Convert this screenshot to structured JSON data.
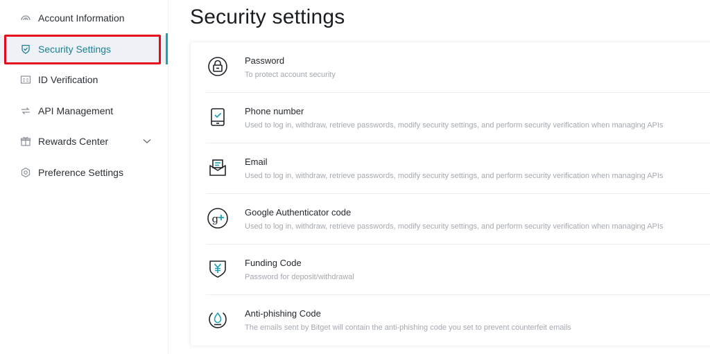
{
  "sidebar": {
    "items": [
      {
        "label": "Account Information",
        "icon": "dashboard-gauge-icon",
        "active": false
      },
      {
        "label": "Security Settings",
        "icon": "shield-check-icon",
        "active": true
      },
      {
        "label": "ID Verification",
        "icon": "id-card-icon",
        "active": false
      },
      {
        "label": "API Management",
        "icon": "api-arrows-icon",
        "active": false
      },
      {
        "label": "Rewards Center",
        "icon": "gift-icon",
        "active": false,
        "expandable": true
      },
      {
        "label": "Preference Settings",
        "icon": "hexagon-gear-icon",
        "active": false
      }
    ]
  },
  "main": {
    "title": "Security settings",
    "settings": [
      {
        "title": "Password",
        "description": "To protect account security",
        "icon": "lock-icon"
      },
      {
        "title": "Phone number",
        "description": "Used to log in, withdraw, retrieve passwords, modify security settings, and perform security verification when managing APIs",
        "icon": "phone-check-icon"
      },
      {
        "title": "Email",
        "description": "Used to log in, withdraw, retrieve passwords, modify security settings, and perform security verification when managing APIs",
        "icon": "envelope-icon"
      },
      {
        "title": "Google Authenticator code",
        "description": "Used to log in, withdraw, retrieve passwords, modify security settings, and perform security verification when managing APIs",
        "icon": "google-plus-icon"
      },
      {
        "title": "Funding Code",
        "description": "Password for deposit/withdrawal",
        "icon": "yen-shield-icon"
      },
      {
        "title": "Anti-phishing Code",
        "description": "The emails sent by Bitget will contain the anti-phishing code you set to prevent counterfeit emails",
        "icon": "water-drop-icon"
      }
    ]
  },
  "colors": {
    "accent": "#1ea0b5",
    "active_text": "#1b7e93",
    "highlight_border": "#e5091b"
  }
}
